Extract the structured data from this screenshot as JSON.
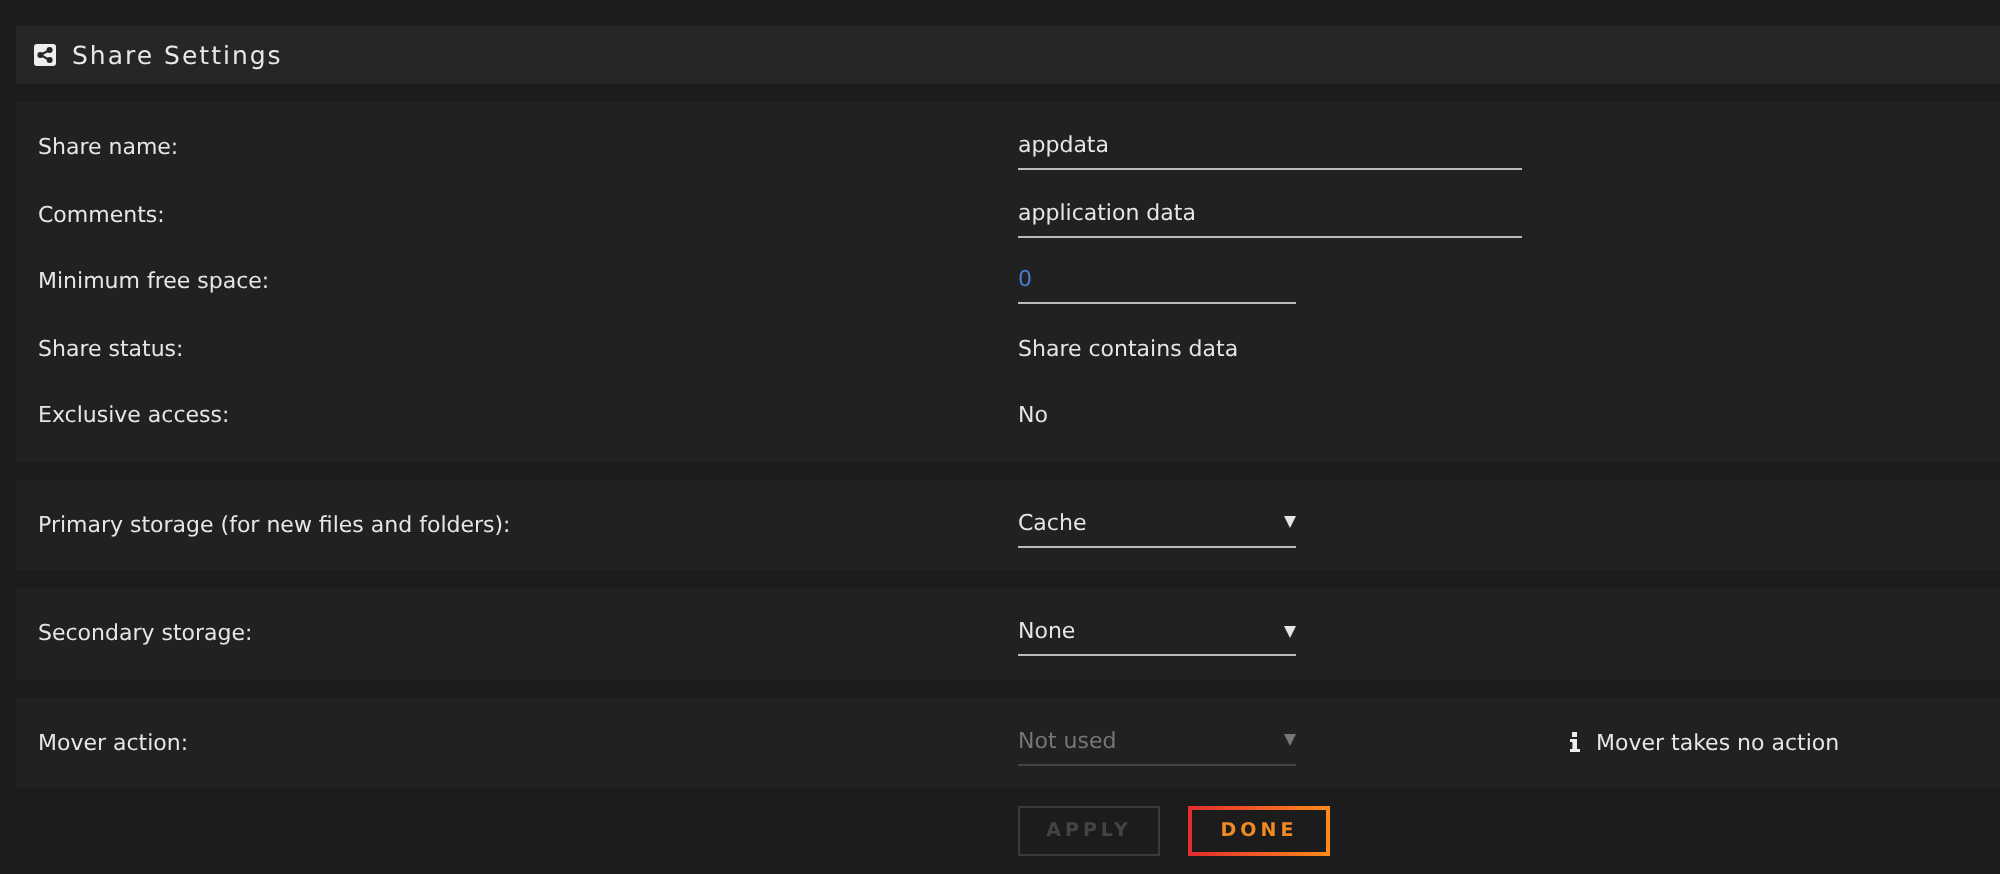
{
  "header": {
    "title": "Share Settings"
  },
  "sections": [
    {
      "rows": [
        {
          "label": "Share name:",
          "kind": "text",
          "value": "appdata"
        },
        {
          "label": "Comments:",
          "kind": "text",
          "value": "application data"
        },
        {
          "label": "Minimum free space:",
          "kind": "number",
          "value": "0"
        },
        {
          "label": "Share status:",
          "kind": "static",
          "value": "Share contains data"
        },
        {
          "label": "Exclusive access:",
          "kind": "static",
          "value": "No"
        }
      ]
    },
    {
      "rows": [
        {
          "label": "Primary storage (for new files and folders):",
          "kind": "select",
          "value": "Cache",
          "disabled": false
        }
      ]
    },
    {
      "rows": [
        {
          "label": "Secondary storage:",
          "kind": "select",
          "value": "None",
          "disabled": false
        }
      ]
    },
    {
      "rows": [
        {
          "label": "Mover action:",
          "kind": "select",
          "value": "Not used",
          "disabled": true,
          "note": "Mover takes no action"
        }
      ]
    }
  ],
  "buttons": [
    {
      "label": "APPLY",
      "disabled": true
    },
    {
      "label": "DONE",
      "disabled": false
    }
  ]
}
